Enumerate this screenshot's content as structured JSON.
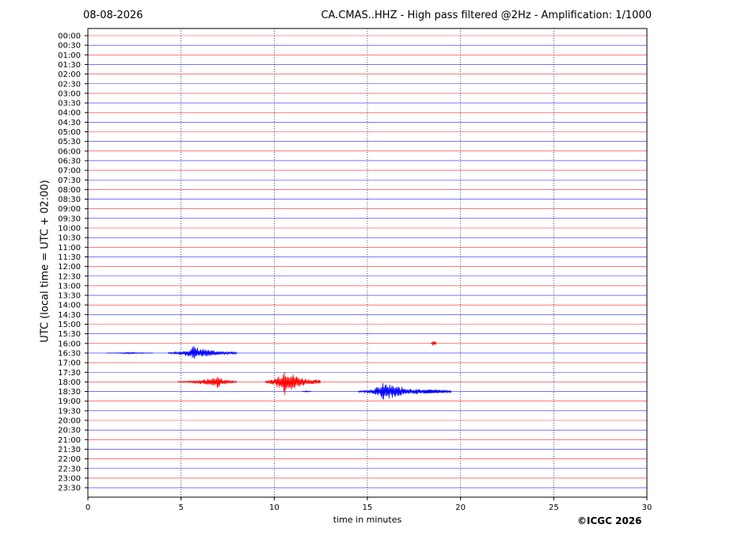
{
  "header": {
    "date": "08-08-2026",
    "title": "CA.CMAS..HHZ - High pass filtered @2Hz - Amplification: 1/1000"
  },
  "footer": {
    "copyright": "©ICGC 2026"
  },
  "chart_data": {
    "type": "line",
    "title": "CA.CMAS..HHZ - High pass filtered @2Hz - Amplification: 1/1000",
    "xlabel": "time in minutes",
    "ylabel": "UTC (local time = UTC + 02:00)",
    "xlim": [
      0,
      30
    ],
    "x_ticks": [
      0,
      5,
      10,
      15,
      20,
      25,
      30
    ],
    "x_grid": "dotted",
    "rows": [
      "00:00",
      "00:30",
      "01:00",
      "01:30",
      "02:00",
      "02:30",
      "03:00",
      "03:30",
      "04:00",
      "04:30",
      "05:00",
      "05:30",
      "06:00",
      "06:30",
      "07:00",
      "07:30",
      "08:00",
      "08:30",
      "09:00",
      "09:30",
      "10:00",
      "10:30",
      "11:00",
      "11:30",
      "12:00",
      "12:30",
      "13:00",
      "13:30",
      "14:00",
      "14:30",
      "15:00",
      "15:30",
      "16:00",
      "16:30",
      "17:00",
      "17:30",
      "18:00",
      "18:30",
      "19:00",
      "19:30",
      "20:00",
      "20:30",
      "21:00",
      "21:30",
      "22:00",
      "22:30",
      "23:00",
      "23:30"
    ],
    "row_colors": [
      "#ff0000",
      "#0000ff"
    ],
    "events": [
      {
        "row": "16:00",
        "start": 18.4,
        "end": 18.7,
        "peak": 18.5,
        "amplitude": 0.4
      },
      {
        "row": "16:30",
        "start": 1.0,
        "end": 3.5,
        "peak": 2.2,
        "amplitude": 0.12
      },
      {
        "row": "16:30",
        "start": 4.3,
        "end": 8.0,
        "peak": 5.6,
        "amplitude": 0.85
      },
      {
        "row": "18:00",
        "start": 4.8,
        "end": 8.0,
        "peak": 6.9,
        "amplitude": 0.75
      },
      {
        "row": "18:00",
        "start": 9.5,
        "end": 12.5,
        "peak": 10.5,
        "amplitude": 1.6
      },
      {
        "row": "18:30",
        "start": 11.5,
        "end": 12.0,
        "peak": 11.7,
        "amplitude": 0.1
      },
      {
        "row": "18:30",
        "start": 14.5,
        "end": 19.5,
        "peak": 15.8,
        "amplitude": 1.0
      },
      {
        "row": "18:30",
        "start": 17.5,
        "end": 19.5,
        "peak": 18.3,
        "amplitude": 0.25
      }
    ]
  }
}
